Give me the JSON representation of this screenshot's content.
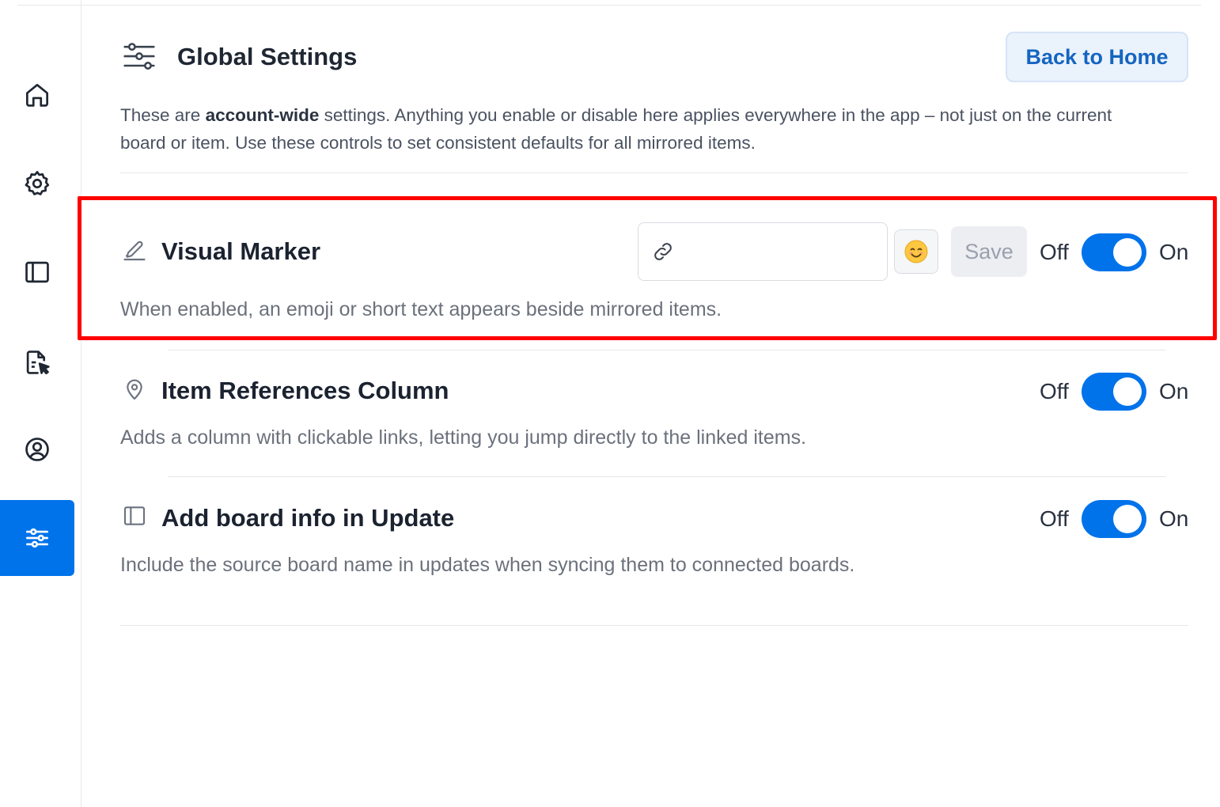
{
  "header": {
    "title": "Global Settings",
    "back_button": "Back to Home",
    "intro_prefix": "These are ",
    "intro_bold": "account-wide",
    "intro_suffix": " settings. Anything you enable or disable here applies everywhere in the app – not just on the current board or item. Use these controls to set consistent defaults for all mirrored items."
  },
  "sidebar": {
    "items": [
      {
        "icon": "home-icon",
        "active": false
      },
      {
        "icon": "gear-icon",
        "active": false
      },
      {
        "icon": "panel-icon",
        "active": false
      },
      {
        "icon": "document-cursor-icon",
        "active": false
      },
      {
        "icon": "user-circle-icon",
        "active": false
      },
      {
        "icon": "sliders-icon",
        "active": true
      }
    ]
  },
  "settings": [
    {
      "title": "Visual Marker",
      "description": "When enabled, an emoji or short text appears beside mirrored items.",
      "icon": "pencil-icon",
      "input_value": "",
      "emoji": "😊",
      "save_label": "Save",
      "off_label": "Off",
      "on_label": "On",
      "enabled": true
    },
    {
      "title": "Item References Column",
      "description": "Adds a column with clickable links, letting you jump directly to the linked items.",
      "icon": "location-pin-icon",
      "off_label": "Off",
      "on_label": "On",
      "enabled": true
    },
    {
      "title": "Add board info in Update",
      "description": "Include the source board name in updates when syncing them to connected boards.",
      "icon": "panel-icon",
      "off_label": "Off",
      "on_label": "On",
      "enabled": true
    }
  ],
  "colors": {
    "accent": "#0073ea",
    "highlight": "#ff0000",
    "back_button_text": "#1565c0"
  }
}
